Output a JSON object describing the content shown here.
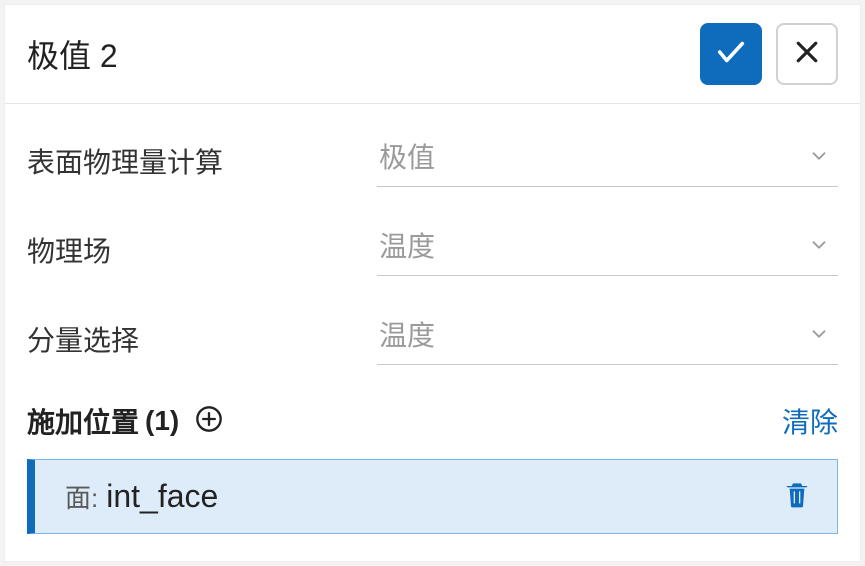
{
  "header": {
    "title": "极值 2"
  },
  "fields": {
    "surface_calc": {
      "label": "表面物理量计算",
      "value": "极值"
    },
    "physics": {
      "label": "物理场",
      "value": "温度"
    },
    "component": {
      "label": "分量选择",
      "value": "温度"
    }
  },
  "location": {
    "title": "施加位置",
    "count": "(1)",
    "clear": "清除",
    "item_prefix": "面:",
    "item_name": "int_face"
  },
  "colors": {
    "accent": "#0f6cbd"
  }
}
